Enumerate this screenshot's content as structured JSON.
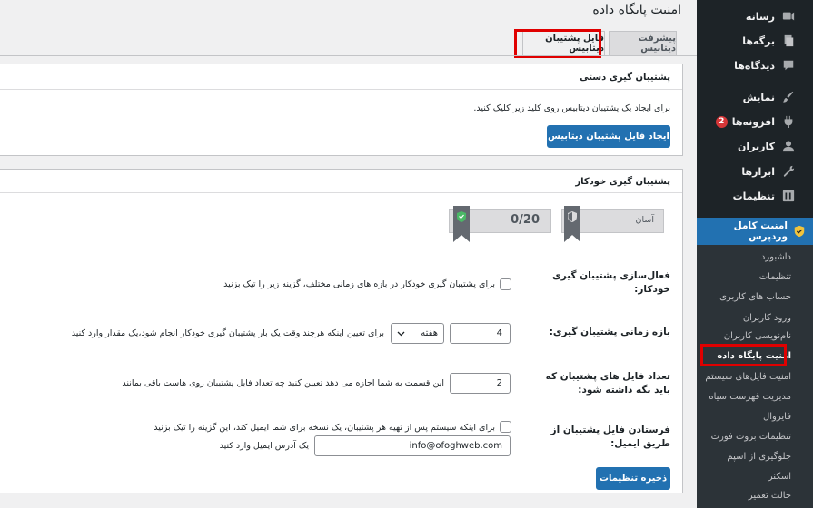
{
  "page": {
    "title": "امنیت پایگاه داده"
  },
  "tabs": [
    {
      "label": "پیشرفت دیتابیس"
    },
    {
      "label": "فایل پشتیبان دیتابیس"
    }
  ],
  "manual_backup": {
    "title": "پشتیبان گیری دستی",
    "description": "برای ایجاد یک پشتیبان دیتابیس روی کلید زیر کلیک کنید.",
    "button": "ایجاد فایل پشتیبان دیتابیس"
  },
  "auto_backup": {
    "title": "پشتیبان گیری خودکار",
    "score": "0/20",
    "level": "آسان",
    "enable": {
      "label": "فعال‌سازی پشتیبان گیری خودکار:",
      "desc": "برای پشتیبان گیری خودکار در بازه های زمانی مختلف، گزینه زیر را تیک بزنید"
    },
    "interval": {
      "label": "بازه زمانی پشتیبان گیری:",
      "value": "4",
      "unit": "هفته",
      "desc": "برای تعیین اینکه هرچند وقت یک بار پشتیبان گیری خودکار انجام شود،یک مقدار وارد کنید"
    },
    "keep": {
      "label": "تعداد فایل های پشتیبان که باید نگه داشته شود:",
      "value": "2",
      "desc": "این قسمت به شما اجازه می دهد تعیین کنید چه تعداد فایل پشتیبان روی هاست باقی بمانند"
    },
    "email": {
      "label": "فرستادن فایل پشتیبان از طریق ایمیل:",
      "desc": "برای اینکه سیستم پس از تهیه هر پشتیبان، یک نسخه برای شما ایمیل کند، این گزینه را تیک بزنید",
      "value": "info@ofoghweb.com",
      "hint": "یک آدرس ایمیل وارد کنید"
    },
    "save": "ذخیره تنظیمات"
  },
  "sidebar": {
    "items": [
      {
        "label": "رسانه",
        "icon": "media-icon"
      },
      {
        "label": "برگه‌ها",
        "icon": "pages-icon"
      },
      {
        "label": "دیدگاه‌ها",
        "icon": "comments-icon"
      },
      {
        "label": "نمایش",
        "icon": "appearance-icon"
      },
      {
        "label": "افزونه‌ها",
        "icon": "plugins-icon",
        "badge": "2"
      },
      {
        "label": "کاربران",
        "icon": "users-icon"
      },
      {
        "label": "ابزارها",
        "icon": "tools-icon"
      },
      {
        "label": "تنظیمات",
        "icon": "settings-icon"
      }
    ],
    "active": "امنیت کامل وردپرس",
    "submenu": [
      "داشبورد",
      "تنظیمات",
      "حساب های کاربری",
      "ورود کاربران",
      "نام‌نویسی کاربران",
      "امنیت پایگاه داده",
      "امنیت فایل‌های سیستم",
      "مدیریت فهرست سیاه",
      "فایروال",
      "تنظیمات بروت فورث",
      "جلوگیری از اسپم",
      "اسکنر",
      "حالت تعمیر"
    ]
  },
  "colors": {
    "accent": "#2271b1",
    "sidebar": "#1d2327",
    "highlight": "#e00000",
    "badge": "#d63638"
  }
}
